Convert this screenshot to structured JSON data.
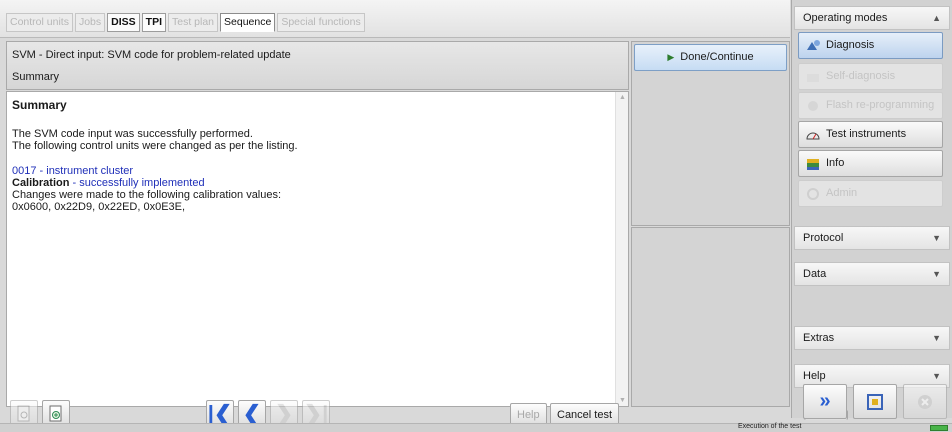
{
  "tabs": [
    {
      "label": "Control units",
      "state": "disabled"
    },
    {
      "label": "Jobs",
      "state": "disabled"
    },
    {
      "label": "DISS",
      "state": "active"
    },
    {
      "label": "TPI",
      "state": "active"
    },
    {
      "label": "Test plan",
      "state": "disabled"
    },
    {
      "label": "Sequence",
      "state": "selected"
    },
    {
      "label": "Special functions",
      "state": "disabled"
    }
  ],
  "header": {
    "title": "SVM - Direct input: SVM code for problem-related update",
    "subtitle": "Summary"
  },
  "content": {
    "heading": "Summary",
    "line1": "The SVM code input was successfully performed.",
    "line2": "The following control units were changed as per the listing.",
    "unit": "0017 - instrument cluster",
    "calibration_label": "Calibration",
    "calibration_status": " - successfully implemented",
    "changes_line": "Changes were made to the following calibration values:",
    "values": "0x0600, 0x22D9, 0x22ED, 0x0E3E,"
  },
  "toolbar": {
    "help_label": "Help",
    "cancel_label": "Cancel test"
  },
  "middle": {
    "done_label": "Done/Continue"
  },
  "operating_modes": {
    "title": "Operating modes",
    "items": [
      {
        "label": "Diagnosis",
        "state": "active",
        "icon": "diagnosis-icon"
      },
      {
        "label": "Self-diagnosis",
        "state": "disabled",
        "icon": "self-diagnosis-icon"
      },
      {
        "label": "Flash re-programming",
        "state": "disabled",
        "icon": "flash-icon"
      },
      {
        "label": "Test instruments",
        "state": "normal",
        "icon": "gauge-icon"
      },
      {
        "label": "Info",
        "state": "normal",
        "icon": "book-icon"
      },
      {
        "label": "Admin",
        "state": "disabled",
        "icon": "admin-icon"
      }
    ]
  },
  "sections": [
    {
      "label": "Protocol"
    },
    {
      "label": "Data"
    },
    {
      "label": "Extras"
    },
    {
      "label": "Help"
    }
  ],
  "status_bar": {
    "text": "Execution of the test"
  },
  "colors": {
    "accent_blue": "#2a5fd1",
    "link_blue": "#1f2fb8",
    "active_button": "#c6dcf3",
    "progress_green": "#49b449"
  }
}
